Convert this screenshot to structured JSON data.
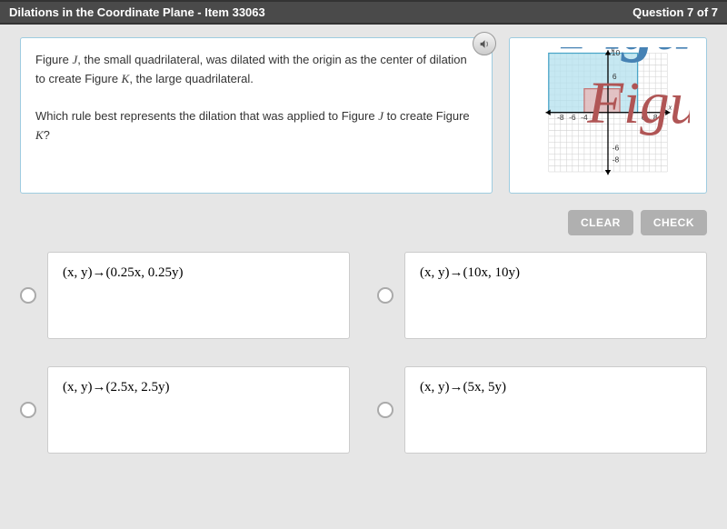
{
  "header": {
    "title": "Dilations in the Coordinate Plane - Item 33063",
    "question_counter": "Question 7 of 7"
  },
  "question": {
    "part1_a": "Figure ",
    "j": "J",
    "part1_b": ", the small quadrilateral, was dilated with the origin as the center of dilation to create Figure ",
    "k": "K",
    "part1_c": ", the large quadrilateral.",
    "part2_a": "Which rule best represents the dilation that was applied to Figure ",
    "j2": "J",
    "part2_b": " to create Figure ",
    "k2": "K",
    "part2_c": "?"
  },
  "figure": {
    "label_k": "Figure K",
    "label_j": "Figure J",
    "axis_x": "x",
    "axis_y": "y",
    "ticks": {
      "n8": "-8",
      "n6": "-6",
      "n4": "-4",
      "p6": "6",
      "p8": "8",
      "p10": "10"
    }
  },
  "buttons": {
    "clear": "CLEAR",
    "check": "CHECK"
  },
  "options": {
    "a": "(x, y)→(0.25x, 0.25y)",
    "b": "(x, y)→(10x, 10y)",
    "c": "(x, y)→(2.5x, 2.5y)",
    "d": "(x, y)→(5x, 5y)"
  },
  "icons": {
    "audio": "audio-icon"
  }
}
